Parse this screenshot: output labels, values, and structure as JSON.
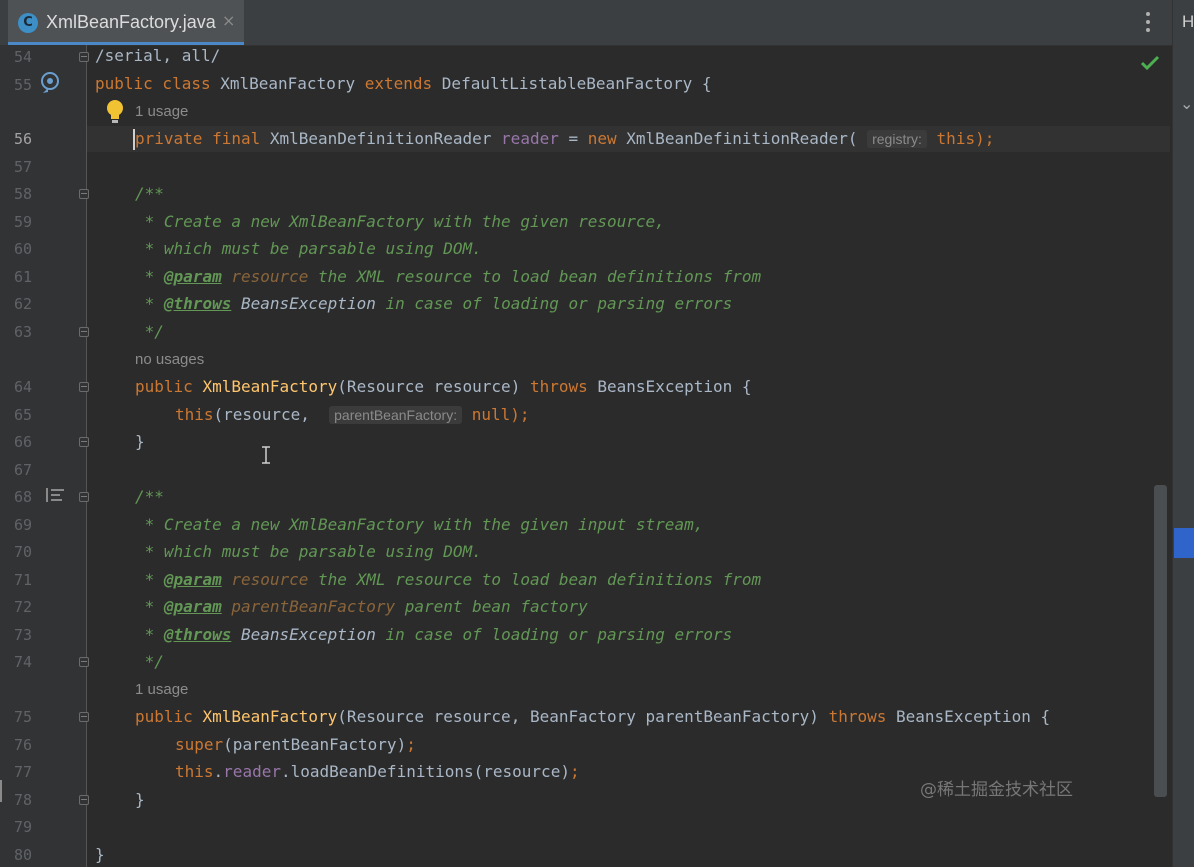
{
  "tab": {
    "icon_letter": "C",
    "title": "XmlBeanFactory.java",
    "close": "×"
  },
  "right_panel": {
    "label": "H",
    "chevron": "⌄"
  },
  "watermark": "@稀土掘金技术社区",
  "line_numbers": [
    "54",
    "55",
    "56",
    "57",
    "58",
    "59",
    "60",
    "61",
    "62",
    "63",
    "64",
    "65",
    "66",
    "67",
    "68",
    "69",
    "70",
    "71",
    "72",
    "73",
    "74",
    "75",
    "76",
    "77",
    "78",
    "79",
    "80"
  ],
  "current_line": "56",
  "code": {
    "l54": "/serial, all/",
    "l55": {
      "k1": "public class ",
      "name": "XmlBeanFactory ",
      "k2": "extends ",
      "parent": "DefaultListableBeanFactory {"
    },
    "usage_56": "1 usage",
    "l56": {
      "k1": "private final ",
      "type": "XmlBeanDefinitionReader ",
      "field": "reader",
      "eq": " = ",
      "k2": "new ",
      "ctor": "XmlBeanDefinitionReader(",
      "hint": "registry:",
      "k3": "this",
      "end": ");"
    },
    "l58": "/**",
    "l59": " * Create a new XmlBeanFactory with the given resource,",
    "l60": " * which must be parsable using DOM.",
    "l61": {
      "star": " * ",
      "tag": "@param",
      "param": " resource",
      "text": " the XML resource to load bean definitions from"
    },
    "l62": {
      "star": " * ",
      "tag": "@throws",
      "ref": " BeansException",
      "text": " in case of loading or parsing errors"
    },
    "l63": " */",
    "usage_64": "no usages",
    "l64": {
      "k1": "public ",
      "fn": "XmlBeanFactory",
      "args": "(Resource resource) ",
      "k2": "throws ",
      "rest": "BeansException {"
    },
    "l65": {
      "k1": "this",
      "args": "(resource, ",
      "hint": "parentBeanFactory:",
      "k2": "null",
      "end": ");"
    },
    "l66": "}",
    "l68": "/**",
    "l69": " * Create a new XmlBeanFactory with the given input stream,",
    "l70": " * which must be parsable using DOM.",
    "l71": {
      "star": " * ",
      "tag": "@param",
      "param": " resource",
      "text": " the XML resource to load bean definitions from"
    },
    "l72": {
      "star": " * ",
      "tag": "@param",
      "param": " parentBeanFactory",
      "text": " parent bean factory"
    },
    "l73": {
      "star": " * ",
      "tag": "@throws",
      "ref": " BeansException",
      "text": " in case of loading or parsing errors"
    },
    "l74": " */",
    "usage_75": "1 usage",
    "l75": {
      "k1": "public ",
      "fn": "XmlBeanFactory",
      "args": "(Resource resource, BeanFactory parentBeanFactory) ",
      "k2": "throws ",
      "rest": "BeansException {"
    },
    "l76": {
      "k1": "super",
      "args": "(parentBeanFactory)",
      "end": ";"
    },
    "l77": {
      "k1": "this",
      "dot": ".",
      "field": "reader",
      "call": ".loadBeanDefinitions(resource)",
      "end": ";"
    },
    "l78": "}",
    "l80": "}"
  }
}
